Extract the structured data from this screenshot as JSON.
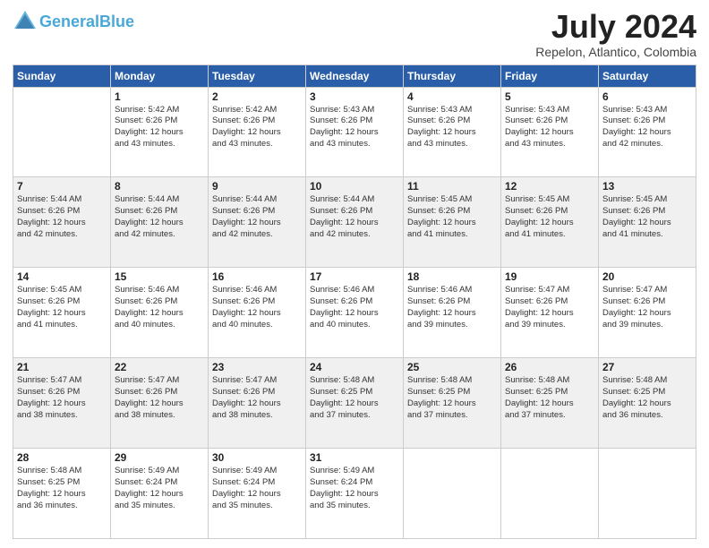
{
  "header": {
    "logo_line1": "General",
    "logo_line2": "Blue",
    "title": "July 2024",
    "location": "Repelon, Atlantico, Colombia"
  },
  "weekdays": [
    "Sunday",
    "Monday",
    "Tuesday",
    "Wednesday",
    "Thursday",
    "Friday",
    "Saturday"
  ],
  "weeks": [
    [
      {
        "day": "",
        "info": ""
      },
      {
        "day": "1",
        "info": "Sunrise: 5:42 AM\nSunset: 6:26 PM\nDaylight: 12 hours\nand 43 minutes."
      },
      {
        "day": "2",
        "info": "Sunrise: 5:42 AM\nSunset: 6:26 PM\nDaylight: 12 hours\nand 43 minutes."
      },
      {
        "day": "3",
        "info": "Sunrise: 5:43 AM\nSunset: 6:26 PM\nDaylight: 12 hours\nand 43 minutes."
      },
      {
        "day": "4",
        "info": "Sunrise: 5:43 AM\nSunset: 6:26 PM\nDaylight: 12 hours\nand 43 minutes."
      },
      {
        "day": "5",
        "info": "Sunrise: 5:43 AM\nSunset: 6:26 PM\nDaylight: 12 hours\nand 43 minutes."
      },
      {
        "day": "6",
        "info": "Sunrise: 5:43 AM\nSunset: 6:26 PM\nDaylight: 12 hours\nand 42 minutes."
      }
    ],
    [
      {
        "day": "7",
        "info": "Sunrise: 5:44 AM\nSunset: 6:26 PM\nDaylight: 12 hours\nand 42 minutes."
      },
      {
        "day": "8",
        "info": "Sunrise: 5:44 AM\nSunset: 6:26 PM\nDaylight: 12 hours\nand 42 minutes."
      },
      {
        "day": "9",
        "info": "Sunrise: 5:44 AM\nSunset: 6:26 PM\nDaylight: 12 hours\nand 42 minutes."
      },
      {
        "day": "10",
        "info": "Sunrise: 5:44 AM\nSunset: 6:26 PM\nDaylight: 12 hours\nand 42 minutes."
      },
      {
        "day": "11",
        "info": "Sunrise: 5:45 AM\nSunset: 6:26 PM\nDaylight: 12 hours\nand 41 minutes."
      },
      {
        "day": "12",
        "info": "Sunrise: 5:45 AM\nSunset: 6:26 PM\nDaylight: 12 hours\nand 41 minutes."
      },
      {
        "day": "13",
        "info": "Sunrise: 5:45 AM\nSunset: 6:26 PM\nDaylight: 12 hours\nand 41 minutes."
      }
    ],
    [
      {
        "day": "14",
        "info": "Sunrise: 5:45 AM\nSunset: 6:26 PM\nDaylight: 12 hours\nand 41 minutes."
      },
      {
        "day": "15",
        "info": "Sunrise: 5:46 AM\nSunset: 6:26 PM\nDaylight: 12 hours\nand 40 minutes."
      },
      {
        "day": "16",
        "info": "Sunrise: 5:46 AM\nSunset: 6:26 PM\nDaylight: 12 hours\nand 40 minutes."
      },
      {
        "day": "17",
        "info": "Sunrise: 5:46 AM\nSunset: 6:26 PM\nDaylight: 12 hours\nand 40 minutes."
      },
      {
        "day": "18",
        "info": "Sunrise: 5:46 AM\nSunset: 6:26 PM\nDaylight: 12 hours\nand 39 minutes."
      },
      {
        "day": "19",
        "info": "Sunrise: 5:47 AM\nSunset: 6:26 PM\nDaylight: 12 hours\nand 39 minutes."
      },
      {
        "day": "20",
        "info": "Sunrise: 5:47 AM\nSunset: 6:26 PM\nDaylight: 12 hours\nand 39 minutes."
      }
    ],
    [
      {
        "day": "21",
        "info": "Sunrise: 5:47 AM\nSunset: 6:26 PM\nDaylight: 12 hours\nand 38 minutes."
      },
      {
        "day": "22",
        "info": "Sunrise: 5:47 AM\nSunset: 6:26 PM\nDaylight: 12 hours\nand 38 minutes."
      },
      {
        "day": "23",
        "info": "Sunrise: 5:47 AM\nSunset: 6:26 PM\nDaylight: 12 hours\nand 38 minutes."
      },
      {
        "day": "24",
        "info": "Sunrise: 5:48 AM\nSunset: 6:25 PM\nDaylight: 12 hours\nand 37 minutes."
      },
      {
        "day": "25",
        "info": "Sunrise: 5:48 AM\nSunset: 6:25 PM\nDaylight: 12 hours\nand 37 minutes."
      },
      {
        "day": "26",
        "info": "Sunrise: 5:48 AM\nSunset: 6:25 PM\nDaylight: 12 hours\nand 37 minutes."
      },
      {
        "day": "27",
        "info": "Sunrise: 5:48 AM\nSunset: 6:25 PM\nDaylight: 12 hours\nand 36 minutes."
      }
    ],
    [
      {
        "day": "28",
        "info": "Sunrise: 5:48 AM\nSunset: 6:25 PM\nDaylight: 12 hours\nand 36 minutes."
      },
      {
        "day": "29",
        "info": "Sunrise: 5:49 AM\nSunset: 6:24 PM\nDaylight: 12 hours\nand 35 minutes."
      },
      {
        "day": "30",
        "info": "Sunrise: 5:49 AM\nSunset: 6:24 PM\nDaylight: 12 hours\nand 35 minutes."
      },
      {
        "day": "31",
        "info": "Sunrise: 5:49 AM\nSunset: 6:24 PM\nDaylight: 12 hours\nand 35 minutes."
      },
      {
        "day": "",
        "info": ""
      },
      {
        "day": "",
        "info": ""
      },
      {
        "day": "",
        "info": ""
      }
    ]
  ]
}
